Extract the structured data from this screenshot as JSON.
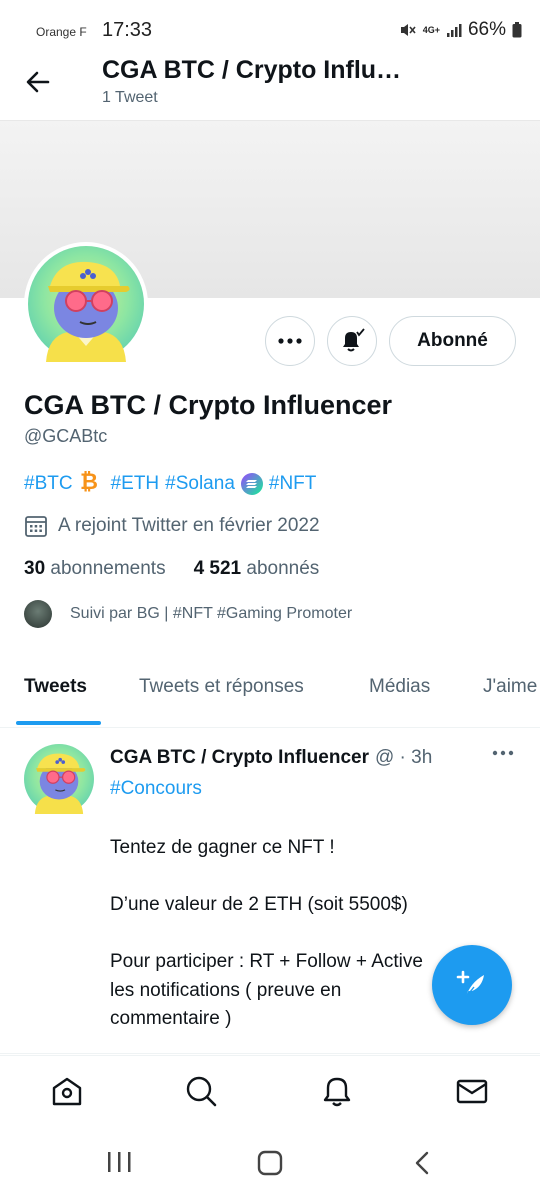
{
  "status_bar": {
    "carrier": "Orange F",
    "time": "17:33",
    "network": "4G+",
    "battery": "66%"
  },
  "header": {
    "title": "CGA BTC / Crypto Influ…",
    "subtitle": "1 Tweet",
    "back_icon": "arrow-left-icon"
  },
  "profile": {
    "display_name": "CGA BTC / Crypto Influencer",
    "handle": "@GCABtc",
    "bio": {
      "tag_btc": "#BTC",
      "tag_eth": "#ETH",
      "tag_solana": "#Solana",
      "tag_nft": "#NFT"
    },
    "joined": "A rejoint Twitter en février 2022",
    "following_count": "30",
    "following_label": "abonnements",
    "followers_count": "4 521",
    "followers_label": "abonnés",
    "followed_by": "Suivi par BG | #NFT #Gaming Promoter",
    "follow_button": "Abonné"
  },
  "tabs": [
    {
      "label": "Tweets",
      "active": true
    },
    {
      "label": "Tweets et réponses",
      "active": false
    },
    {
      "label": "Médias",
      "active": false
    },
    {
      "label": "J'aime",
      "active": false
    }
  ],
  "tweet": {
    "name": "CGA BTC / Crypto Influencer",
    "meta": "@ · 3h",
    "hashtag": "#Concours",
    "lines": [
      "Tentez de gagner ce NFT !",
      "D’une valeur de 2 ETH (soit 5500$)",
      "Pour participer : RT + Follow + Active les notifications ( preuve en commentaire )"
    ]
  },
  "colors": {
    "accent": "#1d9bf0",
    "text": "#0f1419",
    "secondary": "#536471",
    "bitcoin": "#f7931a"
  }
}
